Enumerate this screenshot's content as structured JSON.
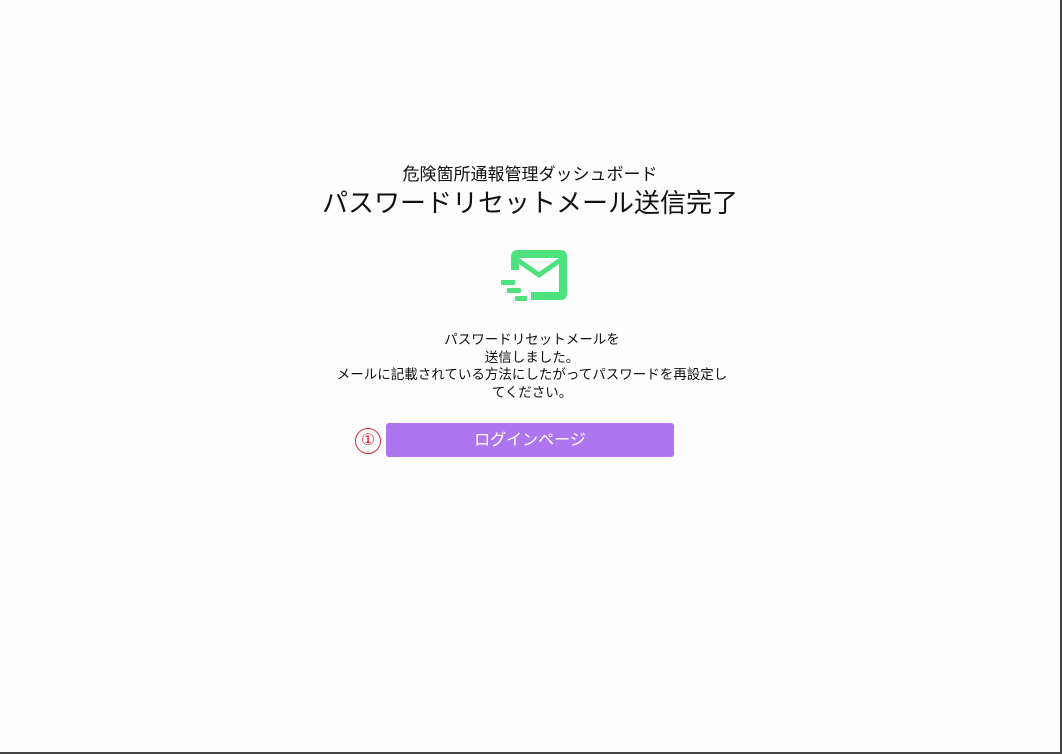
{
  "header": {
    "app_name": "危険箇所通報管理ダッシュボード",
    "title": "パスワードリセットメール送信完了"
  },
  "icon": {
    "name": "mail-sent-icon",
    "color": "#4ee27f"
  },
  "message": {
    "lines": [
      "パスワードリセットメールを",
      "送信しました。",
      "メールに記載されている方法にしたがってパスワードを再設定し",
      "てください。"
    ]
  },
  "actions": {
    "step_marker": "①",
    "step_marker_color": "#e0283a",
    "login_button_label": "ログインページ",
    "login_button_color": "#ae76ee"
  }
}
